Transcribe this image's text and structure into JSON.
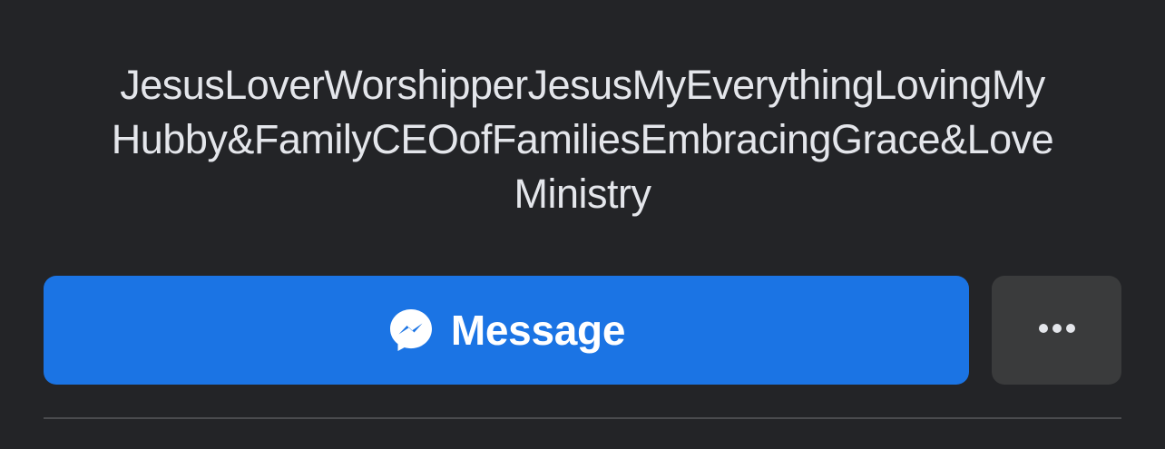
{
  "profile": {
    "bio_lines": [
      "JesusLoverWorshipperJesusMyEverythingLovingMy",
      "Hubby&FamilyCEOofFamiliesEmbracingGrace&Love",
      "Ministry"
    ]
  },
  "actions": {
    "message_label": "Message",
    "message_icon": "messenger-icon",
    "more_icon": "more-horizontal-icon"
  },
  "colors": {
    "background": "#232427",
    "primary_button": "#1b74e4",
    "secondary_button": "#3a3b3c",
    "text": "#e4e6eb"
  }
}
